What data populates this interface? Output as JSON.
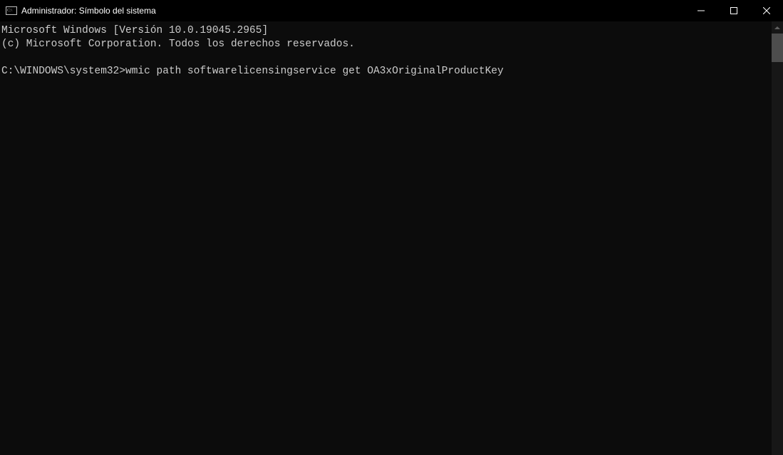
{
  "titlebar": {
    "title": "Administrador: Símbolo del sistema"
  },
  "terminal": {
    "line1": "Microsoft Windows [Versión 10.0.19045.2965]",
    "line2": "(c) Microsoft Corporation. Todos los derechos reservados.",
    "blank": "",
    "prompt": "C:\\WINDOWS\\system32>",
    "command": "wmic path softwarelicensingservice get OA3xOriginalProductKey"
  }
}
